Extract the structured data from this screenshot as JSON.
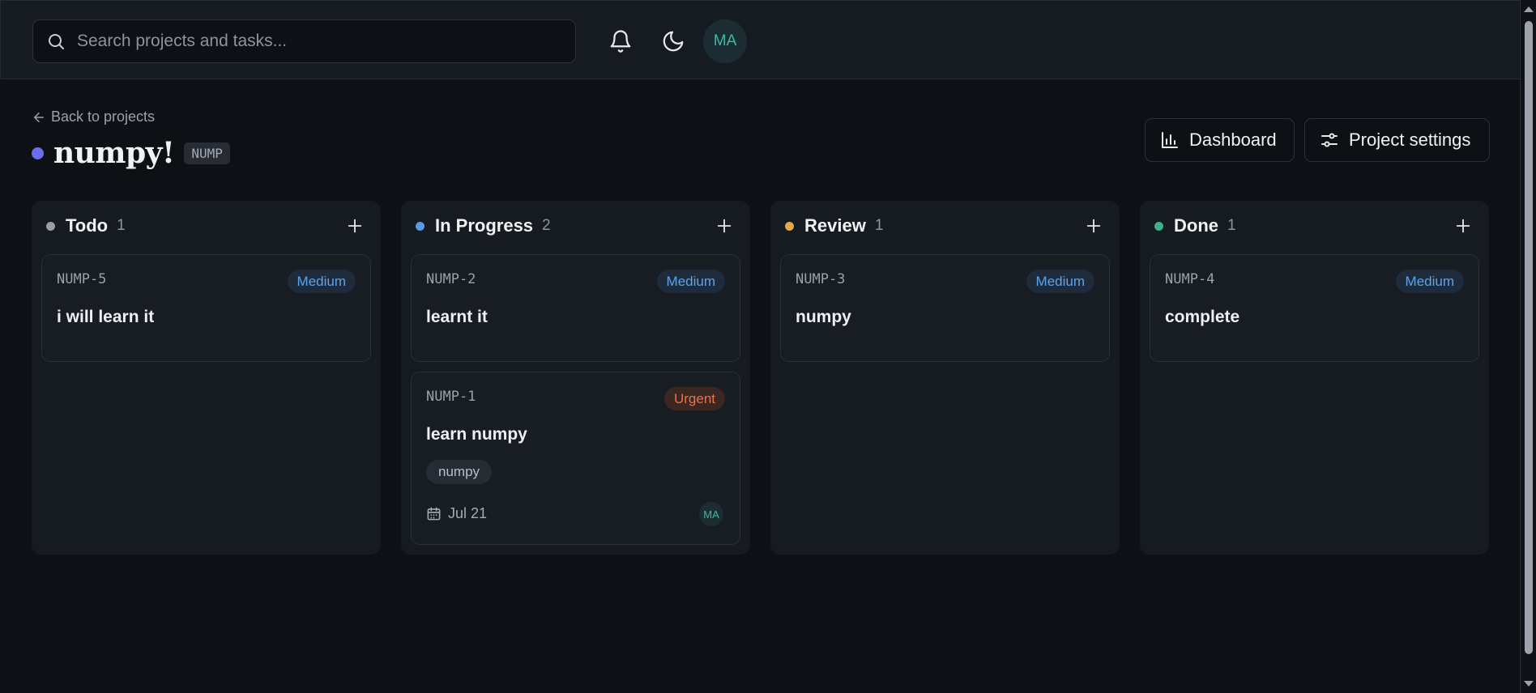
{
  "header": {
    "search_placeholder": "Search projects and tasks...",
    "search_value": "",
    "user_initials": "MA",
    "icons": [
      "search-icon",
      "bell-icon",
      "moon-icon"
    ]
  },
  "project": {
    "back_label": "Back to projects",
    "name": "numpy!",
    "key": "NUMP",
    "color": "#6b6cf0",
    "actions": {
      "dashboard_label": "Dashboard",
      "settings_label": "Project settings"
    }
  },
  "columns": [
    {
      "name": "Todo",
      "count": "1",
      "color": "#9a9ea6",
      "cards": [
        {
          "key": "NUMP-5",
          "priority": "Medium",
          "title": "i will learn it"
        }
      ]
    },
    {
      "name": "In Progress",
      "count": "2",
      "color": "#5a9be0",
      "cards": [
        {
          "key": "NUMP-2",
          "priority": "Medium",
          "title": "learnt it"
        },
        {
          "key": "NUMP-1",
          "priority": "Urgent",
          "title": "learn numpy",
          "label": "numpy",
          "due": "Jul 21",
          "assignee": "MA"
        }
      ]
    },
    {
      "name": "Review",
      "count": "1",
      "color": "#e0a94a",
      "cards": [
        {
          "key": "NUMP-3",
          "priority": "Medium",
          "title": "numpy"
        }
      ]
    },
    {
      "name": "Done",
      "count": "1",
      "color": "#3fae8a",
      "cards": [
        {
          "key": "NUMP-4",
          "priority": "Medium",
          "title": "complete"
        }
      ]
    }
  ],
  "colors": {
    "priority_medium": "#5ea3e6",
    "priority_urgent": "#e8734a",
    "accent_teal": "#3fb8a6"
  }
}
